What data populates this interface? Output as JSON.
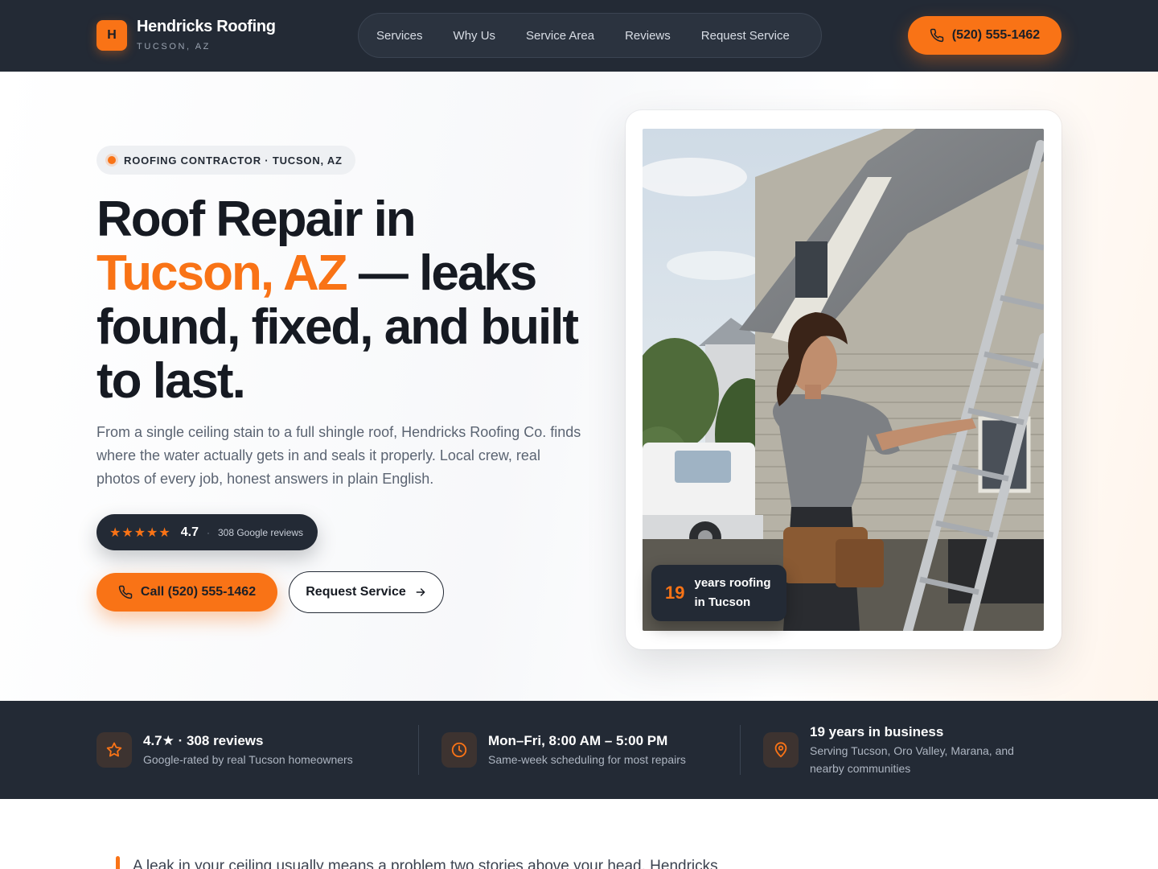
{
  "header": {
    "logo_letter": "H",
    "brand_name": "Hendricks Roofing",
    "brand_city": "TUCSON, AZ",
    "nav": [
      "Services",
      "Why Us",
      "Service Area",
      "Reviews",
      "Request Service"
    ],
    "phone": "(520) 555-1462"
  },
  "hero": {
    "eyebrow": "ROOFING CONTRACTOR · TUCSON, AZ",
    "headline_1": "Roof Repair in",
    "headline_accent": "Tucson, AZ",
    "headline_2": " — leaks found, fixed, and built to last.",
    "lede": "From a single ceiling stain to a full shingle roof, Hendricks Roofing Co. finds where the water actually gets in and seals it properly. Local crew, real photos of every job, honest answers in plain English.",
    "rating": {
      "stars": "★★★★★",
      "score": "4.7",
      "separator": "·",
      "count": "308 Google reviews"
    },
    "call_button": "Call (520) 555-1462",
    "request_button": "Request Service",
    "badge": {
      "number": "19",
      "text_line1": "years roofing",
      "text_line2": "in Tucson"
    }
  },
  "stats": [
    {
      "icon": "star-icon",
      "title": "4.7★ · 308 reviews",
      "desc": "Google-rated by real Tucson homeowners"
    },
    {
      "icon": "clock-icon",
      "title": "Mon–Fri, 8:00 AM – 5:00 PM",
      "desc": "Same-week scheduling for most repairs"
    },
    {
      "icon": "map-pin-icon",
      "title": "19 years in business",
      "desc": "Serving Tucson, Oro Valley, Marana, and nearby communities"
    }
  ],
  "intro": {
    "text": "A leak in your ceiling usually means a problem two stories above your head. Hendricks"
  },
  "colors": {
    "accent": "#f97316",
    "dark": "#232a35"
  }
}
